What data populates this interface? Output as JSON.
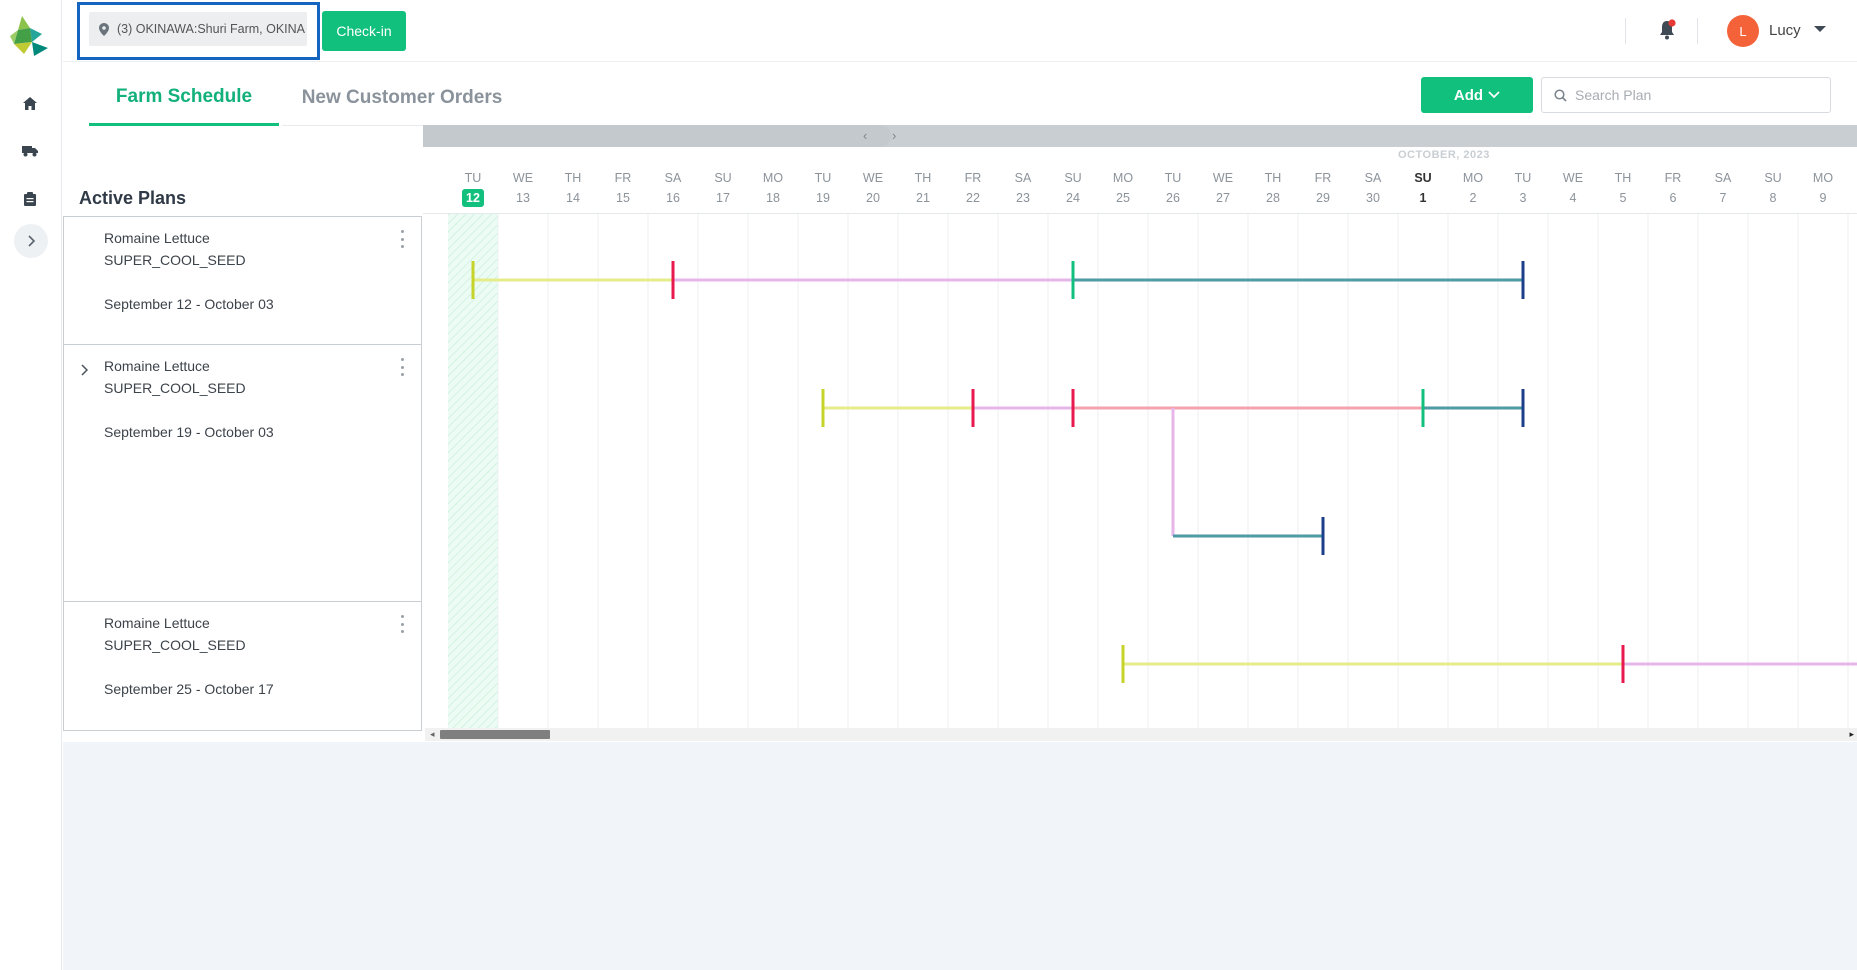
{
  "app": {
    "logo": "agri-logo-icon",
    "accent_color": "#12c07e",
    "highlight_color": "#1565c0"
  },
  "rail": {
    "items": [
      {
        "icon": "home-icon"
      },
      {
        "icon": "truck-icon"
      },
      {
        "icon": "clipboard-icon"
      }
    ],
    "expand_icon": "chevron-right-icon"
  },
  "header": {
    "farm_select": "(3) OKINAWA:Shuri Farm, OKINA",
    "checkin_label": "Check-in",
    "notification_icon": "bell-icon",
    "notification_dot_color": "#e53935",
    "user": {
      "initial": "L",
      "name": "Lucy",
      "avatar_color": "#f4623a"
    }
  },
  "tabs": [
    {
      "label": "Farm Schedule",
      "active": true
    },
    {
      "label": "New Customer Orders",
      "active": false
    }
  ],
  "toolbar": {
    "add_label": "Add",
    "search_placeholder": "Search Plan"
  },
  "plans": {
    "title": "Active Plans",
    "items": [
      {
        "name": "Romaine Lettuce",
        "seed": "SUPER_COOL_SEED",
        "dates": "September 12 - October 03",
        "expandable": false
      },
      {
        "name": "Romaine Lettuce",
        "seed": "SUPER_COOL_SEED",
        "dates": "September 19 - October 03",
        "expandable": true
      },
      {
        "name": "Romaine Lettuce",
        "seed": "SUPER_COOL_SEED",
        "dates": "September 25 - October 17",
        "expandable": false
      }
    ]
  },
  "timeline": {
    "month_label": "OCTOBER, 2023",
    "days": [
      {
        "abbr": "TU",
        "num": "12",
        "today": true
      },
      {
        "abbr": "WE",
        "num": "13"
      },
      {
        "abbr": "TH",
        "num": "14"
      },
      {
        "abbr": "FR",
        "num": "15"
      },
      {
        "abbr": "SA",
        "num": "16"
      },
      {
        "abbr": "SU",
        "num": "17"
      },
      {
        "abbr": "MO",
        "num": "18"
      },
      {
        "abbr": "TU",
        "num": "19"
      },
      {
        "abbr": "WE",
        "num": "20"
      },
      {
        "abbr": "TH",
        "num": "21"
      },
      {
        "abbr": "FR",
        "num": "22"
      },
      {
        "abbr": "SA",
        "num": "23"
      },
      {
        "abbr": "SU",
        "num": "24"
      },
      {
        "abbr": "MO",
        "num": "25"
      },
      {
        "abbr": "TU",
        "num": "26"
      },
      {
        "abbr": "WE",
        "num": "27"
      },
      {
        "abbr": "TH",
        "num": "28"
      },
      {
        "abbr": "FR",
        "num": "29"
      },
      {
        "abbr": "SA",
        "num": "30"
      },
      {
        "abbr": "SU",
        "num": "1",
        "bold": true
      },
      {
        "abbr": "MO",
        "num": "2"
      },
      {
        "abbr": "TU",
        "num": "3"
      },
      {
        "abbr": "WE",
        "num": "4"
      },
      {
        "abbr": "TH",
        "num": "5"
      },
      {
        "abbr": "FR",
        "num": "6"
      },
      {
        "abbr": "SA",
        "num": "7"
      },
      {
        "abbr": "SU",
        "num": "8"
      },
      {
        "abbr": "MO",
        "num": "9"
      }
    ],
    "stage_colors": {
      "stage1": "#e5ec8a",
      "stage1_marker": "#c6d42a",
      "stage2": "#e7b6e9",
      "stage2_marker": "#e8194f",
      "stage3": "#f4a2ae",
      "stage4": "#4e9aa6",
      "stage4_marker": "#12c07e",
      "end_marker": "#1d3f8a"
    },
    "bars": [
      {
        "row": 0,
        "segments": [
          {
            "from": 0,
            "to": 4,
            "stage": "stage1",
            "start_marker": "stage1_marker"
          },
          {
            "from": 4,
            "to": 12,
            "stage": "stage2",
            "start_marker": "stage2_marker"
          },
          {
            "from": 12,
            "to": 21,
            "stage": "stage4",
            "start_marker": "stage4_marker",
            "end_marker": "end_marker"
          }
        ]
      },
      {
        "row": 1,
        "segments": [
          {
            "from": 7,
            "to": 10,
            "stage": "stage1",
            "start_marker": "stage1_marker"
          },
          {
            "from": 10,
            "to": 12,
            "stage": "stage2",
            "start_marker": "stage2_marker"
          },
          {
            "from": 12,
            "to": 19,
            "stage": "stage3",
            "start_marker": "stage2_marker"
          },
          {
            "from": 19,
            "to": 21,
            "stage": "stage4",
            "start_marker": "stage4_marker",
            "end_marker": "end_marker"
          }
        ]
      },
      {
        "row": 2,
        "segments": [
          {
            "from": 14,
            "to": 17,
            "stage": "stage4",
            "end_marker": "end_marker"
          }
        ],
        "branch_from_row": 1,
        "branch_at": 14
      },
      {
        "row": 3,
        "segments": [
          {
            "from": 13,
            "to": 23,
            "stage": "stage1",
            "start_marker": "stage1_marker"
          },
          {
            "from": 23,
            "to": 28,
            "stage": "stage2",
            "start_marker": "stage2_marker"
          }
        ]
      }
    ]
  }
}
